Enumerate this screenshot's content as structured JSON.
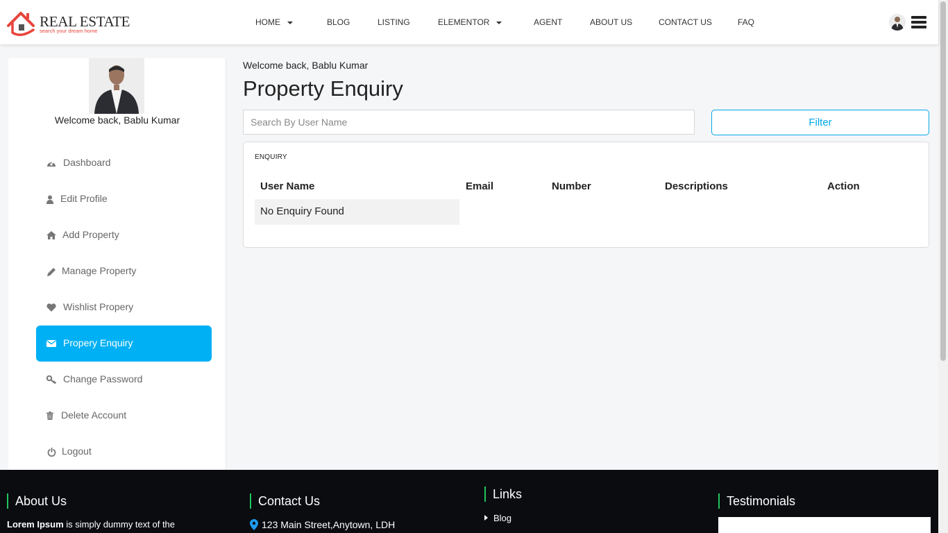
{
  "brand": {
    "name": "REAL ESTATE",
    "tagline": "search your dream home",
    "accent_color": "#e8453c"
  },
  "nav": {
    "items": [
      {
        "label": "HOME",
        "has_dropdown": true
      },
      {
        "label": "BLOG",
        "has_dropdown": false
      },
      {
        "label": "LISTING",
        "has_dropdown": false
      },
      {
        "label": "ELEMENTOR",
        "has_dropdown": true
      },
      {
        "label": "AGENT",
        "has_dropdown": false
      },
      {
        "label": "ABOUT US",
        "has_dropdown": false
      },
      {
        "label": "CONTACT US",
        "has_dropdown": false
      },
      {
        "label": "FAQ",
        "has_dropdown": false
      }
    ],
    "user_icon": "avatar",
    "menu_icon": "hamburger-icon"
  },
  "sidebar": {
    "welcome": "Welcome back, Bablu Kumar",
    "active_color": "#00b0f4",
    "items": [
      {
        "label": "Dashboard",
        "icon": "dashboard-icon",
        "active": false
      },
      {
        "label": "Edit Profile",
        "icon": "user-icon",
        "active": false
      },
      {
        "label": "Add Property",
        "icon": "home-icon",
        "active": false
      },
      {
        "label": "Manage Property",
        "icon": "pencil-icon",
        "active": false
      },
      {
        "label": "Wishlist Propery",
        "icon": "heart-icon",
        "active": false
      },
      {
        "label": "Propery Enquiry",
        "icon": "envelope-icon",
        "active": true
      },
      {
        "label": "Change Password",
        "icon": "key-icon",
        "active": false
      },
      {
        "label": "Delete Account",
        "icon": "trash-icon",
        "active": false
      },
      {
        "label": "Logout",
        "icon": "power-icon",
        "active": false
      }
    ]
  },
  "main": {
    "welcome": "Welcome back, Bablu Kumar",
    "title": "Property Enquiry",
    "search": {
      "placeholder": "Search By User Name",
      "value": ""
    },
    "filter_label": "Filter",
    "accent_color": "#00a8e8",
    "card": {
      "label": "ENQUIRY",
      "columns": [
        "User Name",
        "Email",
        "Number",
        "Descriptions",
        "Action"
      ],
      "empty_text": "No Enquiry Found"
    }
  },
  "footer": {
    "about": {
      "heading": "About Us",
      "text_bold": "Lorem Ipsum",
      "text": "is simply dummy text of the"
    },
    "contact": {
      "heading": "Contact Us",
      "address": "123 Main Street,Anytown, LDH"
    },
    "links": {
      "heading": "Links",
      "items": [
        "Blog"
      ]
    },
    "testimonials": {
      "heading": "Testimonials"
    },
    "divider_color": "#22c55e"
  }
}
